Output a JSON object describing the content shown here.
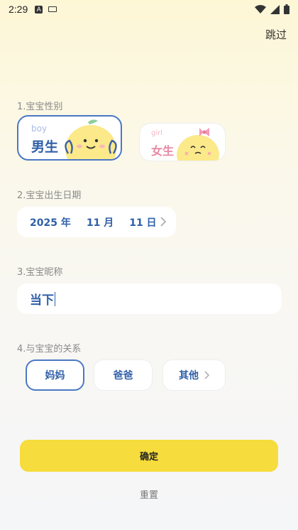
{
  "status_bar": {
    "time": "2:29",
    "icons": [
      "notification-a-icon",
      "keyboard-icon",
      "wifi-icon",
      "signal-icon",
      "battery-icon"
    ]
  },
  "header": {
    "skip_label": "跳过"
  },
  "gender": {
    "label": "1.宝宝性别",
    "options": [
      {
        "en": "boy",
        "cn": "男生",
        "selected": true
      },
      {
        "en": "girl",
        "cn": "女生",
        "selected": false
      }
    ]
  },
  "birth": {
    "label": "2.宝宝出生日期",
    "year": "2025 年",
    "month": "11 月",
    "day": "11 日"
  },
  "nickname": {
    "label": "3.宝宝昵称",
    "value": "当下"
  },
  "relation": {
    "label": "4.与宝宝的关系",
    "options": [
      {
        "label": "妈妈",
        "selected": true
      },
      {
        "label": "爸爸",
        "selected": false
      },
      {
        "label": "其他",
        "selected": false
      }
    ]
  },
  "actions": {
    "confirm_label": "确定",
    "reset_label": "重置"
  },
  "colors": {
    "accent": "#4a78c4",
    "primary_text": "#2f5fa8",
    "confirm_bg": "#f6dc3c",
    "mascot": "#fbe98a"
  }
}
